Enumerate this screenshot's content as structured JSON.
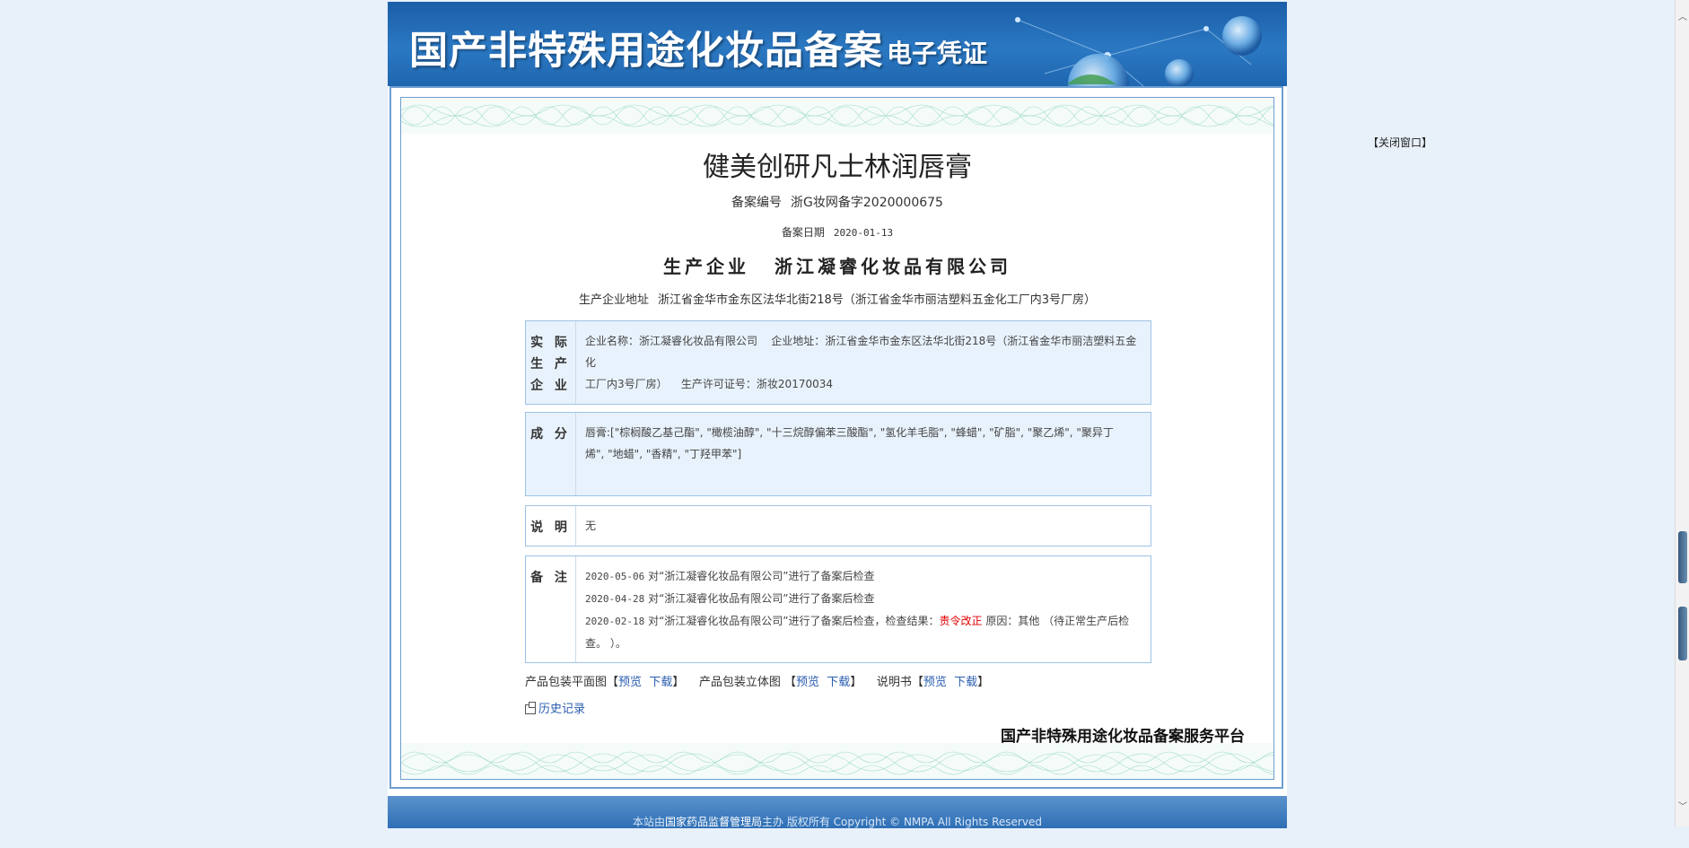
{
  "banner": {
    "title": "国产非特殊用途化妆品备案",
    "subtitle": "电子凭证"
  },
  "product": {
    "name": "健美创研凡士林润唇膏",
    "filing_label": "备案编号",
    "filing_no": "浙G妆网备字2020000675",
    "date_label": "备案日期",
    "date": "2020-01-13",
    "company_label": "生产企业",
    "company": "浙江凝睿化妆品有限公司",
    "address_label": "生产企业地址",
    "address": "浙江省金华市金东区法华北街218号（浙江省金华市丽洁塑料五金化工厂内3号厂房）"
  },
  "actual_producer": {
    "label_lines": [
      "实 际",
      "生 产",
      "企 业"
    ],
    "name_label": "企业名称：",
    "name": "浙江凝睿化妆品有限公司",
    "addr_label": "企业地址：",
    "addr": "浙江省金华市金东区法华北街218号（浙江省金华市丽洁塑料五金化",
    "addr_cont": "工厂内3号厂房）",
    "license_label": "生产许可证号：",
    "license": "浙妆20170034"
  },
  "ingredients": {
    "label": "成 分",
    "line1": "唇膏:[\"棕榈酸乙基己酯\", \"橄榄油醇\", \"十三烷醇偏苯三酸酯\", \"氢化羊毛脂\", \"蜂蜡\", \"矿脂\", \"聚乙烯\", \"聚异丁",
    "line2": "烯\", \"地蜡\", \"香精\", \"丁羟甲苯\"]"
  },
  "note": {
    "label": "说 明",
    "text": "无"
  },
  "remarks": {
    "label": "备 注",
    "entries": [
      {
        "date": "2020-05-06",
        "text": "对“浙江凝睿化妆品有限公司”进行了备案后检查"
      },
      {
        "date": "2020-04-28",
        "text": "对“浙江凝睿化妆品有限公司”进行了备案后检查"
      },
      {
        "date": "2020-02-18",
        "text": "对“浙江凝睿化妆品有限公司”进行了备案后检查，检查结果：",
        "result": "责令改正",
        "reason": "原因：其他 （待正常生产后检",
        "reason_cont": "查。 ）。"
      }
    ]
  },
  "files": {
    "flat_label": "产品包装平面图",
    "stereo_label": "产品包装立体图",
    "manual_label": "说明书",
    "preview": "预览",
    "download": "下载"
  },
  "history": "历史记录",
  "platform": "国产非特殊用途化妆品备案服务平台",
  "footer": {
    "prefix": "本站由",
    "org": "国家药品监督管理局",
    "suffix": "主办 版权所有 Copyright © NMPA All Rights Reserved"
  },
  "close_window": "【关闭窗口】",
  "colors": {
    "banner": "#2b78c2",
    "box_bg": "#e8f2fc",
    "box_border": "#9dc3e6",
    "link": "#2a5db0",
    "alert": "#e00000"
  }
}
